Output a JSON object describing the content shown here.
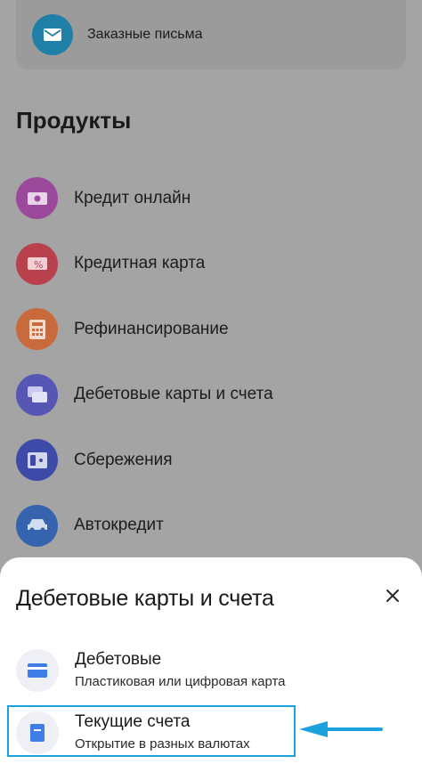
{
  "registered_mail": {
    "label": "Заказные письма",
    "icon": "envelope-icon"
  },
  "products_section": {
    "title": "Продукты",
    "items": [
      {
        "label": "Кредит онлайн",
        "icon": "cash-icon",
        "color": "#b352b3"
      },
      {
        "label": "Кредитная карта",
        "icon": "percent-card-icon",
        "color": "#d6404f"
      },
      {
        "label": "Рефинансирование",
        "icon": "calculator-icon",
        "color": "#e8703a"
      },
      {
        "label": "Дебетовые карты и счета",
        "icon": "cards-icon",
        "color": "#5f5fd8"
      },
      {
        "label": "Сбережения",
        "icon": "wallet-icon",
        "color": "#3f4fd1"
      },
      {
        "label": "Автокредит",
        "icon": "car-icon",
        "color": "#2f6fd3"
      }
    ]
  },
  "sheet": {
    "title": "Дебетовые карты и счета",
    "close_icon": "close-icon",
    "options": [
      {
        "title": "Дебетовые",
        "subtitle": "Пластиковая или цифровая карта",
        "icon": "card-icon",
        "color": "#3f7ee6"
      },
      {
        "title": "Текущие счета",
        "subtitle": "Открытие в разных валютах",
        "icon": "document-icon",
        "color": "#3f7ee6"
      }
    ]
  },
  "annotation": {
    "highlight_color": "#19a2dd",
    "arrow_icon": "arrow-left-icon"
  }
}
